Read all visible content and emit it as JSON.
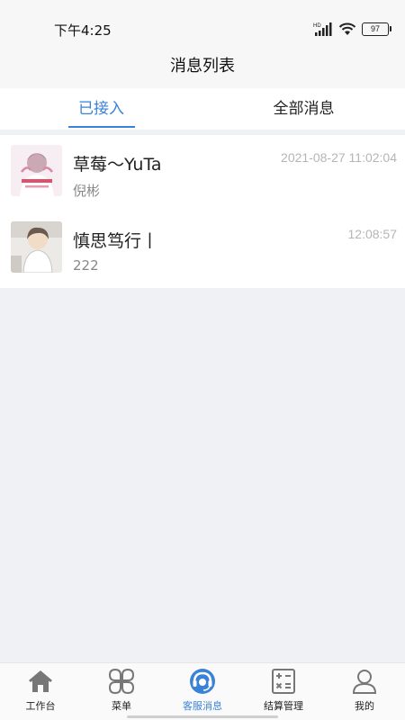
{
  "status_bar": {
    "time": "下午4:25",
    "battery": "97",
    "icons": [
      "hd-signal-icon",
      "wifi-icon",
      "battery-icon"
    ]
  },
  "header": {
    "title": "消息列表"
  },
  "tabs": [
    {
      "label": "已接入",
      "active": true
    },
    {
      "label": "全部消息",
      "active": false
    }
  ],
  "messages": [
    {
      "name": "草莓～YuTa",
      "preview": "倪彬",
      "time": "2021-08-27 11:02:04",
      "avatar": "avatar-photo-1"
    },
    {
      "name": "慎思笃行丨",
      "preview": "222",
      "time": "12:08:57",
      "avatar": "avatar-photo-2"
    }
  ],
  "bottom_nav": [
    {
      "label": "工作台",
      "icon": "home-icon",
      "active": false
    },
    {
      "label": "菜单",
      "icon": "menu-grid-icon",
      "active": false
    },
    {
      "label": "客服消息",
      "icon": "customer-service-icon",
      "active": true
    },
    {
      "label": "结算管理",
      "icon": "calculator-icon",
      "active": false
    },
    {
      "label": "我的",
      "icon": "user-icon",
      "active": false
    }
  ],
  "colors": {
    "accent": "#3a82d8",
    "background": "#f0f1f5",
    "time_text": "#b5b5b5"
  }
}
